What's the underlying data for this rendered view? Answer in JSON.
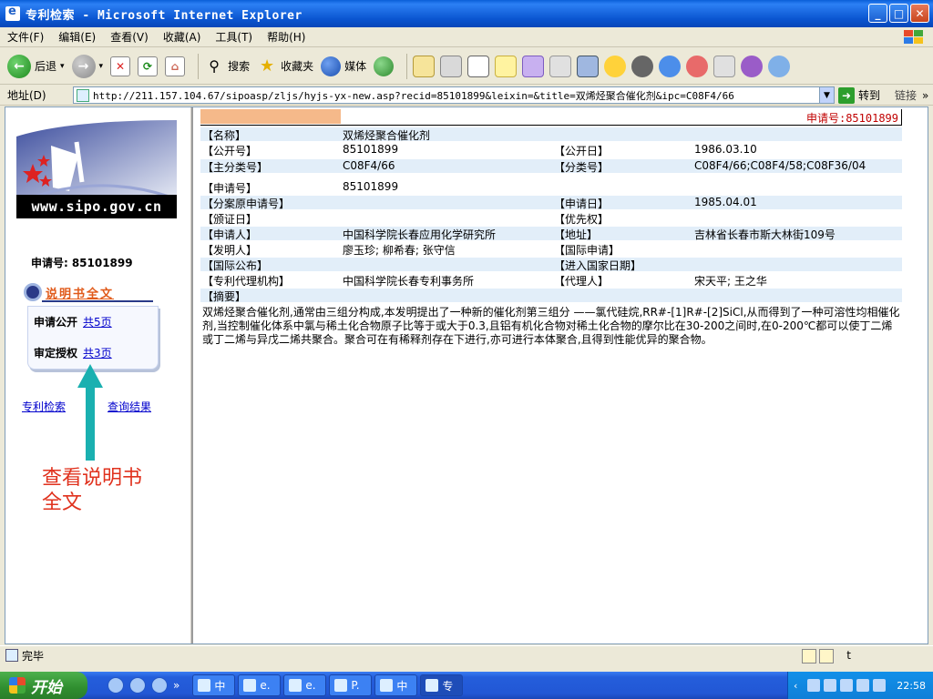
{
  "window": {
    "title": "专利检索 - Microsoft Internet Explorer"
  },
  "menu": [
    "文件(F)",
    "编辑(E)",
    "查看(V)",
    "收藏(A)",
    "工具(T)",
    "帮助(H)"
  ],
  "toolbar": {
    "back": "后退",
    "search": "搜索",
    "favorites": "收藏夹",
    "media": "媒体"
  },
  "address": {
    "label": "地址(D)",
    "url": "http://211.157.104.67/sipoasp/zljs/hyjs-yx-new.asp?recid=85101899&leixin=&title=双烯烃聚合催化剂&ipc=C08F4/66",
    "go": "转到",
    "links": "链接"
  },
  "left": {
    "logo_text": "www.sipo.gov.cn",
    "app_no_label": "申请号:",
    "app_no": "85101899",
    "spec_title": "说明书全文",
    "rows": [
      {
        "label": "申请公开",
        "link": "共5页"
      },
      {
        "label": "审定授权",
        "link": "共3页"
      }
    ],
    "link_search": "专利检索",
    "link_results": "查询结果",
    "annotation": "查看说明书全文"
  },
  "record": {
    "header_app_no": "申请号:85101899",
    "rows": [
      {
        "l1": "【名称】",
        "v1": "双烯烃聚合催化剂",
        "l2": "",
        "v2": ""
      },
      {
        "l1": "【公开号】",
        "v1": "85101899",
        "l2": "【公开日】",
        "v2": "1986.03.10"
      },
      {
        "l1": "【主分类号】",
        "v1": "C08F4/66",
        "l2": "【分类号】",
        "v2": "C08F4/66;C08F4/58;C08F36/04"
      },
      {
        "l1": "【申请号】",
        "v1": "85101899",
        "l2": "",
        "v2": ""
      },
      {
        "l1": "【分案原申请号】",
        "v1": "",
        "l2": "【申请日】",
        "v2": "1985.04.01"
      },
      {
        "l1": "【颁证日】",
        "v1": "",
        "l2": "【优先权】",
        "v2": ""
      },
      {
        "l1": "【申请人】",
        "v1": "中国科学院长春应用化学研究所",
        "l2": "【地址】",
        "v2": "吉林省长春市斯大林街109号"
      },
      {
        "l1": "【发明人】",
        "v1": "廖玉珍; 柳希春; 张守信",
        "l2": "【国际申请】",
        "v2": ""
      },
      {
        "l1": "【国际公布】",
        "v1": "",
        "l2": "【进入国家日期】",
        "v2": ""
      },
      {
        "l1": "【专利代理机构】",
        "v1": "中国科学院长春专利事务所",
        "l2": "【代理人】",
        "v2": "宋天平; 王之华"
      },
      {
        "l1": "【摘要】",
        "v1": "",
        "l2": "",
        "v2": ""
      }
    ],
    "abstract": "双烯烃聚合催化剂,通常由三组分构成,本发明提出了一种新的催化剂第三组分 ——氯代硅烷,RR#-[1]R#-[2]SiCl,从而得到了一种可溶性均相催化剂,当控制催化体系中氯与稀土化合物原子比等于或大于0.3,且铝有机化合物对稀土化合物的摩尔比在30-200之间时,在0-200℃都可以使丁二烯或丁二烯与异戊二烯共聚合。聚合可在有稀释剂存在下进行,亦可进行本体聚合,且得到性能优异的聚合物。"
  },
  "status": {
    "text": "完毕",
    "right": "t"
  },
  "taskbar": {
    "start": "开始",
    "tasks": [
      "中",
      "e.",
      "e.",
      "P.",
      "中",
      "专"
    ],
    "clock": "22:58"
  }
}
